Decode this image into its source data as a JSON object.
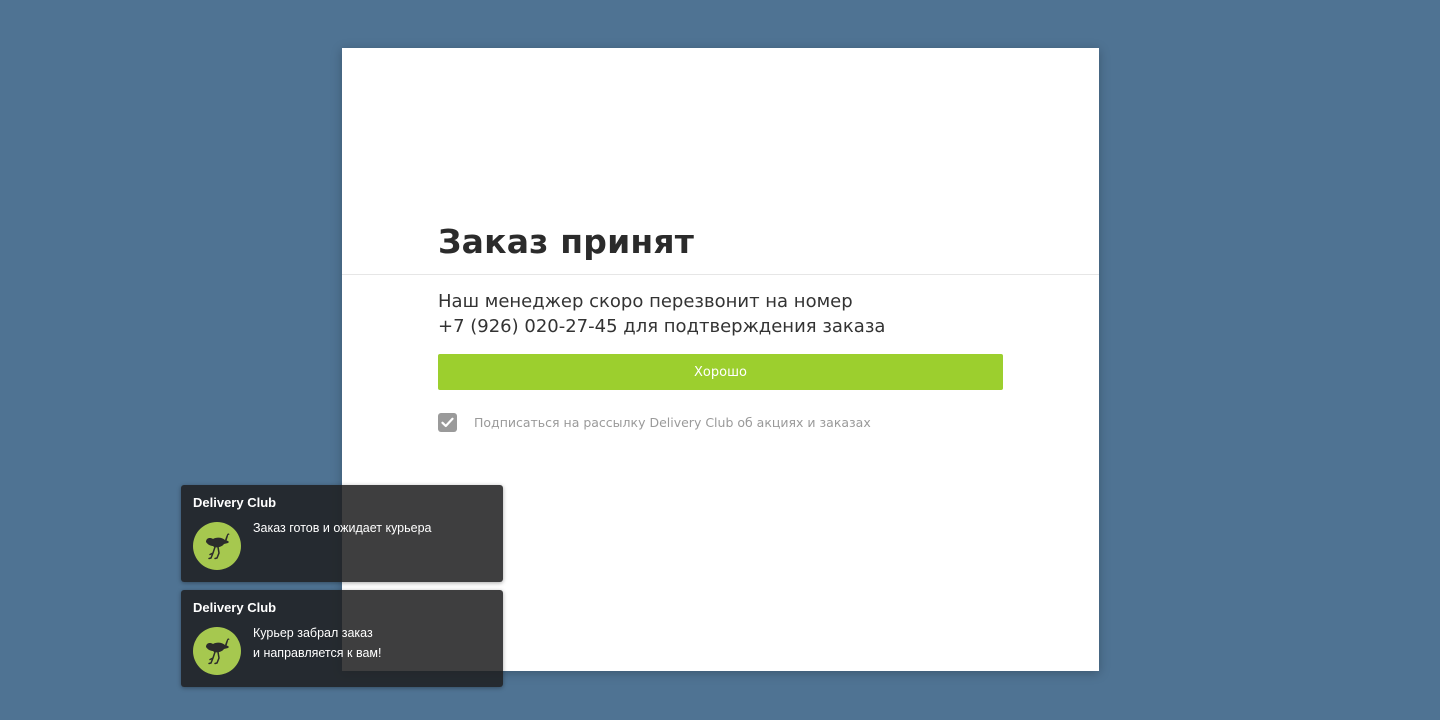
{
  "dialog": {
    "title": "Заказ принят",
    "message_line1": "Наш менеджер скоро перезвонит на номер",
    "message_line2": "+7 (926) 020-27-45 для подтверждения заказа",
    "ok_label": "Хорошо",
    "subscribe_checked": true,
    "subscribe_label": "Подписаться на рассылку Delivery Club об акциях и заказах"
  },
  "notifications": [
    {
      "title": "Delivery Club",
      "icon": "ostrich-icon",
      "line1": "Заказ готов и ожидает курьера",
      "line2": ""
    },
    {
      "title": "Delivery Club",
      "icon": "ostrich-icon",
      "line1": "Курьер забрал заказ",
      "line2": "и направляется к вам!"
    }
  ],
  "colors": {
    "background": "#4f7393",
    "accent": "#9ccf2e",
    "avatar": "#a6c84f"
  }
}
